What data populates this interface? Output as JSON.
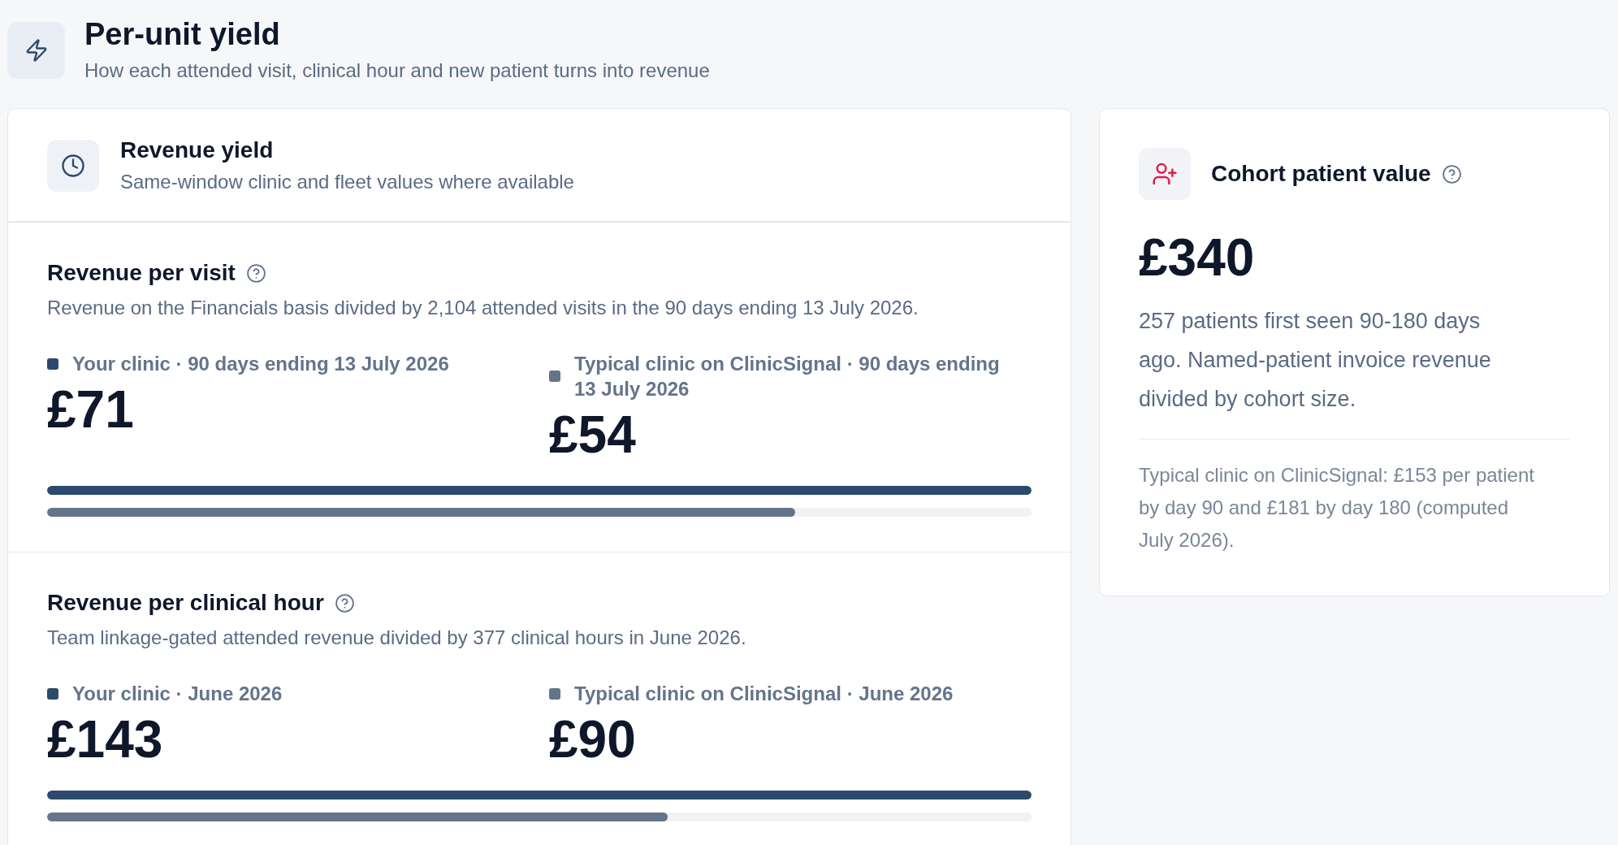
{
  "header": {
    "title": "Per-unit yield",
    "subtitle": "How each attended visit, clinical hour and new patient turns into revenue"
  },
  "revenue_yield": {
    "title": "Revenue yield",
    "subtitle": "Same-window clinic and fleet values where available",
    "metrics": [
      {
        "title": "Revenue per visit",
        "description": "Revenue on the Financials basis divided by 2,104 attended visits in the 90 days ending 13 July 2026.",
        "series": [
          {
            "label": "Your clinic · 90 days ending 13 July 2026",
            "value": "£71",
            "color": "#2c4a6b",
            "level": 1
          },
          {
            "label": "Typical clinic on ClinicSignal · 90 days ending 13 July 2026",
            "value": "£54",
            "color": "#64748b",
            "level": 0.76
          }
        ]
      },
      {
        "title": "Revenue per clinical hour",
        "description": "Team linkage-gated attended revenue divided by 377 clinical hours in June 2026.",
        "series": [
          {
            "label": "Your clinic · June 2026",
            "value": "£143",
            "color": "#2c4a6b",
            "level": 1
          },
          {
            "label": "Typical clinic on ClinicSignal · June 2026",
            "value": "£90",
            "color": "#64748b",
            "level": 0.63
          }
        ]
      }
    ]
  },
  "cohort_patient_value": {
    "title": "Cohort patient value",
    "value": "£340",
    "description": "257 patients first seen 90-180 days ago. Named-patient invoice revenue divided by cohort size.",
    "footnote": "Typical clinic on ClinicSignal: £153 per patient by day 90 and £181 by day 180 (computed July 2026)."
  }
}
